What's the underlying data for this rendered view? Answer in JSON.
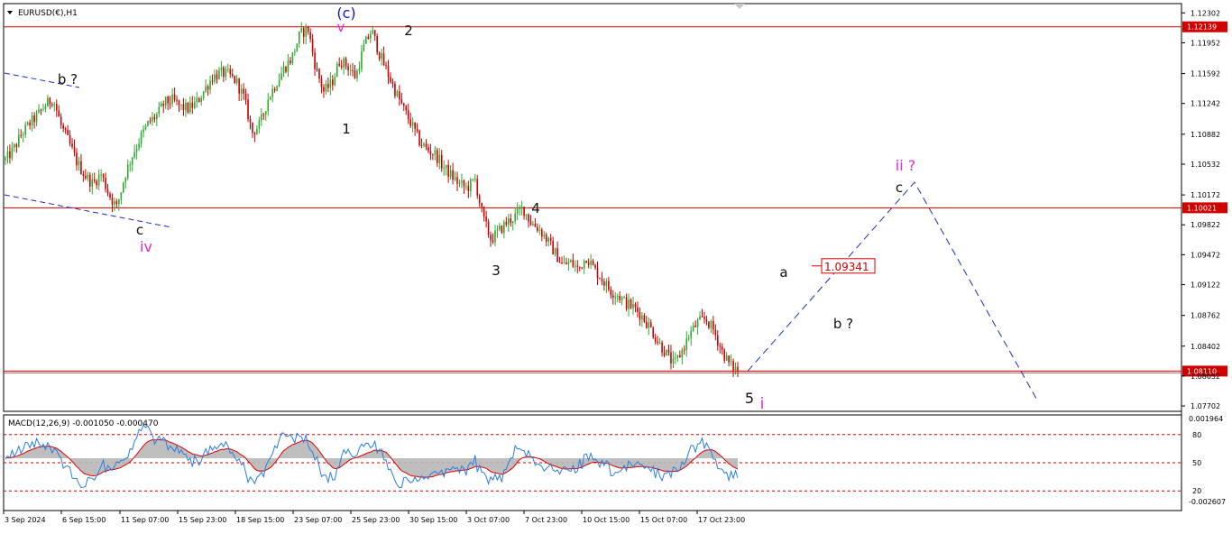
{
  "window": {
    "symbol_title": "EURUSD(€),H1",
    "menu_icon": "triangle-down-icon"
  },
  "chart_data": {
    "type": "candlestick",
    "title": "EURUSD(€),H1",
    "y_range": [
      1.0765,
      1.124
    ],
    "price_ticks": [
      "1.12302",
      "1.11952",
      "1.11592",
      "1.11242",
      "1.10882",
      "1.10532",
      "1.10172",
      "1.09822",
      "1.09472",
      "1.09122",
      "1.08762",
      "1.08402",
      "1.08052",
      "1.07702"
    ],
    "time_ticks": [
      "3 Sep 2024",
      "6 Sep 15:00",
      "11 Sep 07:00",
      "15 Sep 23:00",
      "18 Sep 15:00",
      "23 Sep 07:00",
      "25 Sep 23:00",
      "30 Sep 15:00",
      "3 Oct 07:00",
      "7 Oct 23:00",
      "10 Oct 15:00",
      "15 Oct 07:00",
      "17 Oct 23:00"
    ],
    "horizontal_levels": [
      {
        "label": "1.12139",
        "value": 1.12139
      },
      {
        "label": "1.10021",
        "value": 1.10021
      },
      {
        "label": "1.08110",
        "value": 1.0811
      }
    ],
    "price_path": [
      1.1058,
      1.107,
      1.1088,
      1.11,
      1.111,
      1.1122,
      1.113,
      1.1098,
      1.1078,
      1.1055,
      1.104,
      1.103,
      1.1042,
      1.1018,
      1.1002,
      1.104,
      1.1065,
      1.1085,
      1.1102,
      1.111,
      1.1125,
      1.1128,
      1.112,
      1.1118,
      1.1125,
      1.114,
      1.1155,
      1.116,
      1.1158,
      1.115,
      1.113,
      1.109,
      1.11,
      1.113,
      1.1148,
      1.1165,
      1.1178,
      1.1205,
      1.1212,
      1.1165,
      1.1138,
      1.1148,
      1.1175,
      1.1168,
      1.1155,
      1.119,
      1.121,
      1.1182,
      1.116,
      1.1138,
      1.1118,
      1.11,
      1.108,
      1.107,
      1.1065,
      1.105,
      1.104,
      1.103,
      1.1025,
      1.1035,
      1.099,
      1.0965,
      1.0975,
      1.0985,
      1.0992,
      1.1002,
      1.0985,
      1.0978,
      1.0965,
      1.095,
      1.0935,
      1.0938,
      1.093,
      1.0945,
      1.093,
      1.0918,
      1.0905,
      1.09,
      1.089,
      1.0885,
      1.0875,
      1.0862,
      1.0845,
      1.0832,
      1.0818,
      1.0835,
      1.0855,
      1.0868,
      1.0872,
      1.0858,
      1.0835,
      1.0818,
      1.0812
    ],
    "wave_labels": [
      {
        "text": "(c)",
        "color": "#0b18d8"
      },
      {
        "text": "v",
        "color": "#e02ad2"
      },
      {
        "text": "2",
        "color": "#111111"
      },
      {
        "text": "b ?",
        "color": "#111111"
      },
      {
        "text": "1",
        "color": "#111111"
      },
      {
        "text": "c",
        "color": "#111111"
      },
      {
        "text": "iv",
        "color": "#e02ad2"
      },
      {
        "text": "4",
        "color": "#111111"
      },
      {
        "text": "3",
        "color": "#111111"
      },
      {
        "text": "5",
        "color": "#111111"
      },
      {
        "text": "i",
        "color": "#e02ad2"
      },
      {
        "text": "a",
        "color": "#111111"
      },
      {
        "text": "b ?",
        "color": "#111111"
      },
      {
        "text": "c",
        "color": "#111111"
      },
      {
        "text": "ii ?",
        "color": "#e02ad2"
      }
    ],
    "target_price_label": "1.09341",
    "projection_path": [
      {
        "label": "start",
        "value": 1.0811
      },
      {
        "label": "c",
        "value": 1.1032
      },
      {
        "label": "end",
        "value": 1.0779
      }
    ],
    "colors": {
      "up": "#2eaa2e",
      "down": "#cc0000",
      "level": "#d00000",
      "projection": "#1a2fb8",
      "label_box": "#d00000"
    }
  },
  "macd": {
    "title": "MACD(12,26,9) -0.001050 -0.000470",
    "scale_ticks": [
      "0.001964",
      "80",
      "50",
      "20",
      "-0.002607"
    ],
    "levels": [
      80,
      50,
      20
    ],
    "colors": {
      "signal": "#e00000",
      "main": "#2a7de0",
      "hist": "#b7b7b7"
    }
  }
}
